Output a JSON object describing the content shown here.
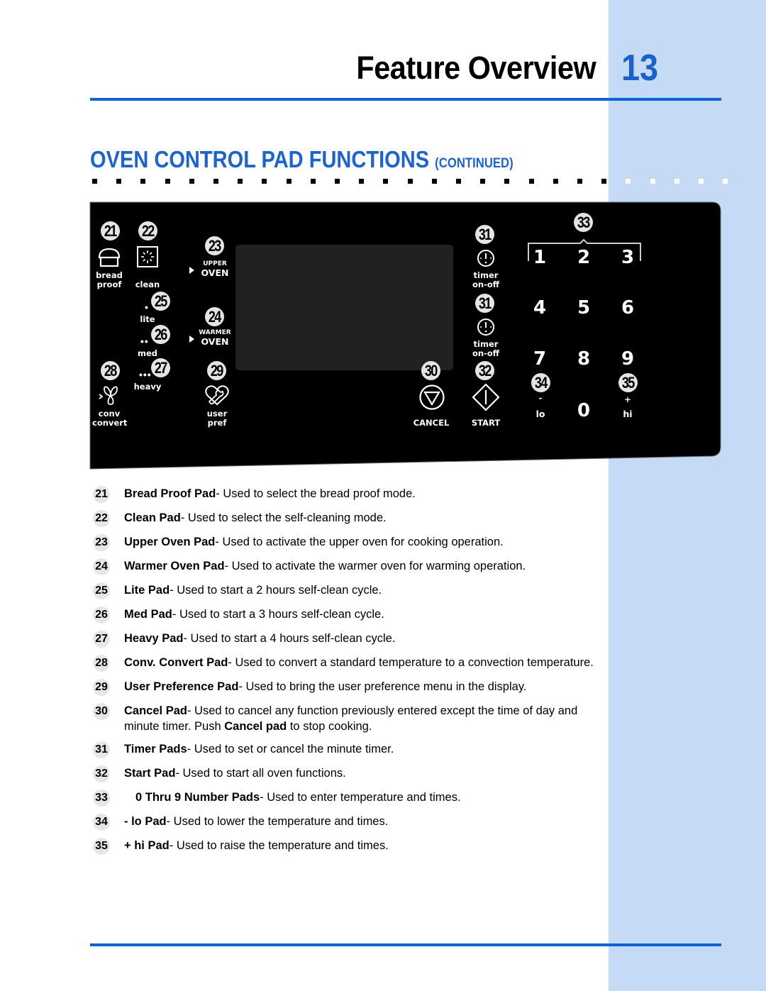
{
  "header": {
    "title": "Feature Overview",
    "page_number": "13"
  },
  "section": {
    "title": "OVEN CONTROL PAD FUNCTIONS",
    "title_suffix": "(CONTINUED)"
  },
  "colors": {
    "accent_blue": "#0a63d8",
    "side_band": "#c4daf5",
    "panel_bg": "#000000",
    "display_bg": "#212121",
    "badge_bg": "#e4e4e4"
  },
  "panel": {
    "badges": {
      "b21": "21",
      "b22": "22",
      "b23": "23",
      "b24": "24",
      "b25": "25",
      "b26": "26",
      "b27": "27",
      "b28": "28",
      "b29": "29",
      "b30": "30",
      "b31a": "31",
      "b31b": "31",
      "b32": "32",
      "b33": "33",
      "b34": "34",
      "b35": "35"
    },
    "pads": {
      "bread_proof": {
        "line1": "bread",
        "line2": "proof",
        "icon": "bread-loaf-icon"
      },
      "clean": {
        "label": "clean",
        "icon": "clean-sparkle-icon"
      },
      "upper_oven": {
        "line1": "UPPER",
        "line2": "OVEN",
        "icon": "triangle-right-icon"
      },
      "warmer_oven": {
        "line1": "WARMER",
        "line2": "OVEN",
        "icon": "triangle-right-icon"
      },
      "lite": {
        "label": "lite",
        "dots": "•"
      },
      "med": {
        "label": "med",
        "dots": "••"
      },
      "heavy": {
        "label": "heavy",
        "dots": "•••"
      },
      "conv_convert": {
        "line1": "conv",
        "line2": "convert",
        "icon": "fan-icon"
      },
      "user_pref": {
        "line1": "user",
        "line2": "pref",
        "icon": "wrench-heart-icon"
      },
      "cancel": {
        "label": "CANCEL",
        "icon": "cancel-triangle-icon"
      },
      "start": {
        "label": "START",
        "icon": "start-diamond-icon"
      },
      "timer1": {
        "line1": "timer",
        "line2": "on-off",
        "icon": "timer-clock-icon"
      },
      "timer2": {
        "line1": "timer",
        "line2": "on-off",
        "icon": "timer-clock-icon"
      },
      "lo": {
        "sign": "-",
        "label": "lo"
      },
      "hi": {
        "sign": "+",
        "label": "hi"
      }
    },
    "keypad": [
      "1",
      "2",
      "3",
      "4",
      "5",
      "6",
      "7",
      "8",
      "9",
      "0"
    ]
  },
  "list": [
    {
      "num": "21",
      "bold": "Bread Proof Pad",
      "text": "- Used to select the bread proof mode."
    },
    {
      "num": "22",
      "bold": "Clean Pad",
      "text": "- Used to select the self-cleaning mode."
    },
    {
      "num": "23",
      "bold": "Upper Oven Pad",
      "text": "- Used to activate the upper oven for cooking operation."
    },
    {
      "num": "24",
      "bold": "Warmer Oven Pad",
      "text": "- Used to activate the warmer oven for warming operation."
    },
    {
      "num": "25",
      "bold": "Lite Pad",
      "text": "- Used to start a 2 hours self-clean cycle."
    },
    {
      "num": "26",
      "bold": "Med Pad",
      "text": "- Used to start a 3 hours self-clean cycle."
    },
    {
      "num": "27",
      "bold": "Heavy Pad",
      "text": "- Used to start a 4 hours self-clean cycle."
    },
    {
      "num": "28",
      "bold": "Conv. Convert Pad",
      "text": "- Used to convert a standard temperature to a convection temperature."
    },
    {
      "num": "29",
      "bold": "User Preference Pad",
      "text": "- Used to bring the user preference menu in the display."
    },
    {
      "num": "30",
      "bold": "Cancel Pad",
      "text": "- Used to cancel any function previously entered except the time of day and minute timer. Push ",
      "bold2": "Cancel pad",
      "text2": " to stop cooking."
    },
    {
      "num": "31",
      "bold": "Timer Pads",
      "text": "- Used to set or cancel the minute timer."
    },
    {
      "num": "32",
      "bold": "Start Pad",
      "text": "- Used to start all oven functions."
    },
    {
      "num": "33",
      "bold": "0 Thru 9 Number Pads",
      "text": "- Used to enter temperature and times."
    },
    {
      "num": "34",
      "bold": "- lo Pad",
      "text": "- Used to lower the temperature and times."
    },
    {
      "num": "35",
      "bold": "+ hi Pad",
      "text": "- Used to raise the temperature and times."
    }
  ]
}
